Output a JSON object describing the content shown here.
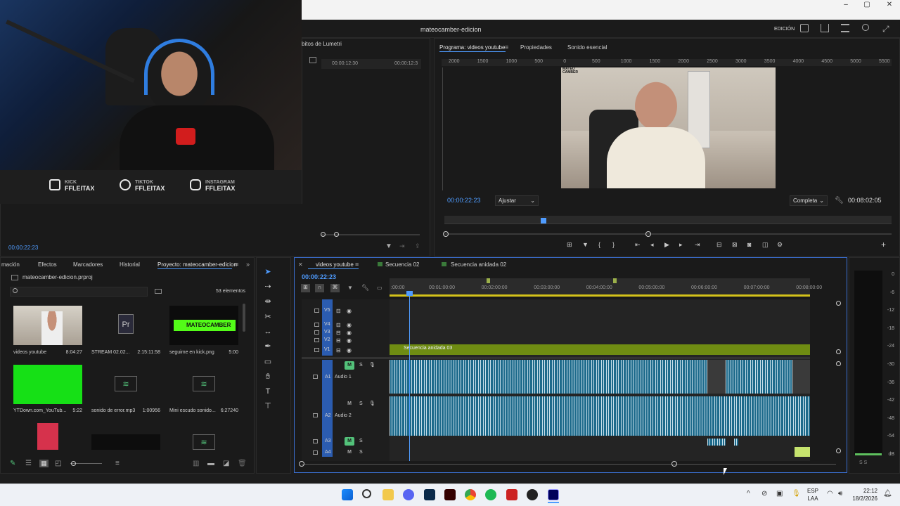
{
  "window": {
    "title": "mateocamber-edicion",
    "workspace": "EDICIÓN",
    "min": "–",
    "max": "▢",
    "close": "✕"
  },
  "webcam": {
    "socials": [
      {
        "platform": "KICK",
        "handle": "FFLEITAX"
      },
      {
        "platform": "TIKTOK",
        "handle": "FFLEITAX"
      },
      {
        "platform": "INSTAGRAM",
        "handle": "FFLEITAX"
      }
    ]
  },
  "source_panel": {
    "tab": "bitos de Lumetri",
    "range_start": "00:00:12:30",
    "range_end": "00:00:12:3",
    "timecode": "00:00:22:23"
  },
  "program": {
    "tabs": [
      "Programa: videos youtube",
      "Propiedades",
      "Sonido esencial"
    ],
    "ruler": [
      "2000",
      "1500",
      "1000",
      "500",
      "0",
      "500",
      "1000",
      "1500",
      "2000",
      "2500",
      "3000",
      "3500",
      "4000",
      "4500",
      "5000",
      "5500"
    ],
    "timecode": "00:00:22:23",
    "fit": "Ajustar",
    "quality": "Completa",
    "duration": "00:08:02:05",
    "video_overlay_text": "MATEO CAMBER"
  },
  "project": {
    "tabs": [
      "mación",
      "Efectos",
      "Marcadores",
      "Historial",
      "Proyecto: mateocamber-edicion"
    ],
    "file": "mateocamber-edicion.prproj",
    "count": "53 elementos",
    "items": [
      {
        "name": "videos youtube",
        "dur": "8:04:27"
      },
      {
        "name": "STREAM 02.02...",
        "dur": "2:15:11:58"
      },
      {
        "name": "seguime en kick.png",
        "dur": "5:00"
      },
      {
        "name": "YTDown.com_YouTub...",
        "dur": "5:22"
      },
      {
        "name": "sonido de error.mp3",
        "dur": "1:00956"
      },
      {
        "name": "Mini escudo sonido...",
        "dur": "6:27240"
      }
    ],
    "kick_thumb": "MATEOCAMBER"
  },
  "timeline": {
    "tabs": [
      "videos youtube",
      "Secuencia 02",
      "Secuencia anidada 02"
    ],
    "timecode": "00:00:22:23",
    "ruler": [
      ":00:00",
      "00:01:00:00",
      "00:02:00:00",
      "00:03:00:00",
      "00:04:00:00",
      "00:05:00:00",
      "00:06:00:00",
      "00:07:00:00",
      "00:08:00:00"
    ],
    "video_tracks": [
      "V5",
      "V4",
      "V3",
      "V2",
      "V1"
    ],
    "audio_tracks": [
      {
        "id": "A1",
        "name": "Audio 1"
      },
      {
        "id": "A2",
        "name": "Audio 2"
      },
      {
        "id": "A3",
        "name": ""
      },
      {
        "id": "A4",
        "name": ""
      }
    ],
    "clip_v1": "Secuencia anidada 03"
  },
  "meter": {
    "labels": [
      "0",
      "-6",
      "-12",
      "-18",
      "-24",
      "-30",
      "-36",
      "-42",
      "-48",
      "-54",
      "dB"
    ],
    "bottom": "S    S"
  },
  "taskbar": {
    "lang": "ESP",
    "layout": "LAA",
    "time": "22:12",
    "date": "18/2/2026"
  },
  "colors": {
    "accent": "#4f9cff",
    "green_clip": "#6f8c12",
    "audio": "#1d6a8b",
    "mute_on": "#53c27a"
  }
}
